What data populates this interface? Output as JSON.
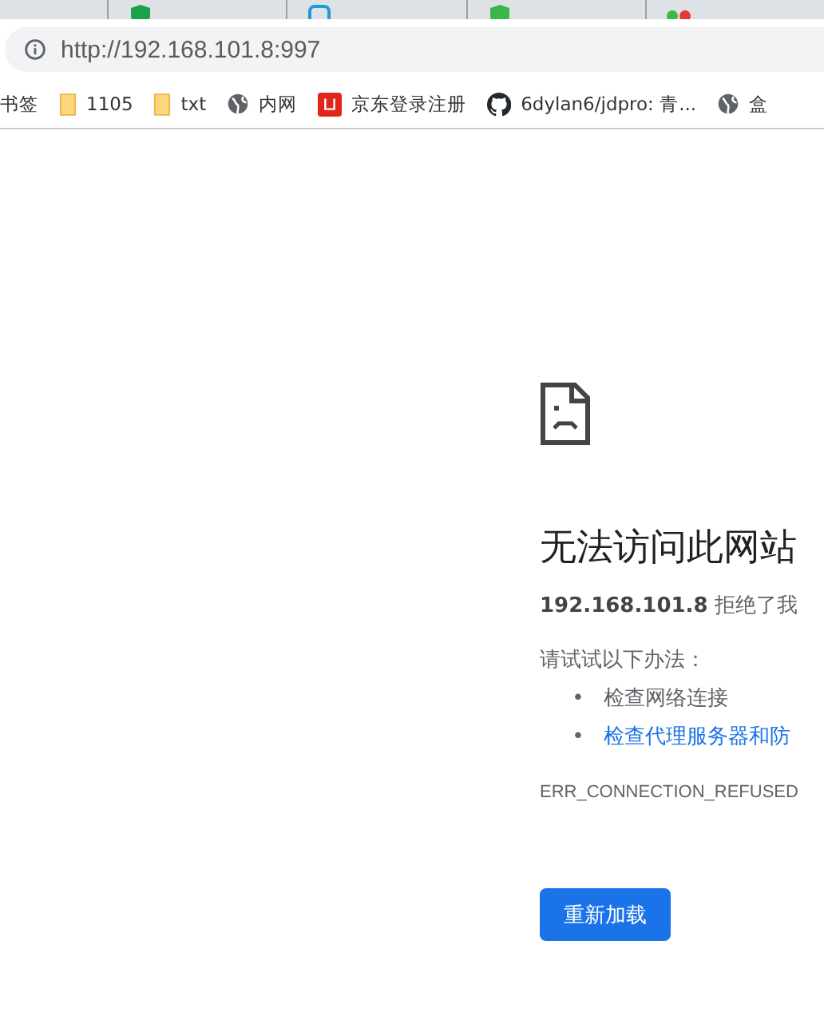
{
  "tabs": [
    {
      "kind": "shield",
      "color": "#1aa34a"
    },
    {
      "kind": "square",
      "color": "#1d9bd7"
    },
    {
      "kind": "shield",
      "color": "#3cb54a"
    },
    {
      "kind": "dots",
      "color": "#e53935"
    }
  ],
  "address_bar": {
    "url": "http://192.168.101.8:997"
  },
  "bookmarks": [
    {
      "kind": "text",
      "label": "书签"
    },
    {
      "kind": "folder",
      "label": "1105"
    },
    {
      "kind": "folder",
      "label": "txt"
    },
    {
      "kind": "globe",
      "label": "内网"
    },
    {
      "kind": "jd",
      "label": "京东登录注册"
    },
    {
      "kind": "github",
      "label": "6dylan6/jdpro: 青..."
    },
    {
      "kind": "globe",
      "label": "盒"
    }
  ],
  "error_page": {
    "heading": "无法访问此网站",
    "message": "**192.168.101.8** 拒绝了我",
    "suggestions_title": "请试试以下办法：",
    "suggestions": [
      {
        "bullet": "•",
        "text": "检查网络连接",
        "link": false
      },
      {
        "bullet": "•",
        "text": "检查代理服务器和防",
        "link": true
      }
    ],
    "error_code": "ERR_CONNECTION_REFUSED",
    "reload_button": "重新加载"
  }
}
